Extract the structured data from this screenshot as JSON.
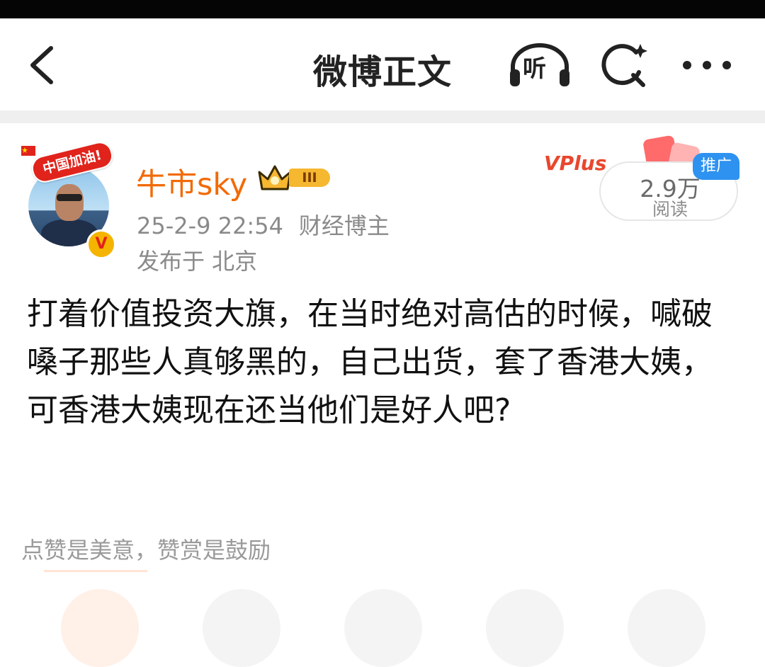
{
  "nav": {
    "title": "微博正文",
    "listen_label": "听"
  },
  "post": {
    "author": {
      "name": "牛市sky",
      "avatar_badge": "中国加油!",
      "verify_mark": "V",
      "level_badge": "III"
    },
    "timestamp": "25-2-9 22:54",
    "author_tag": "财经博主",
    "location": "发布于 北京",
    "promo": {
      "brand": "VPlus",
      "read_count": "2.9万",
      "read_label": "阅读",
      "ad_tag": "推广"
    },
    "body": "打着价值投资大旗，在当时绝对高估的时候，喊破嗓子那些人真够黑的，自己出货，套了香港大姨，可香港大姨现在还当他们是好人吧?",
    "reward_text": "点赞是美意，赞赏是鼓励"
  },
  "colors": {
    "username": "#f26a05",
    "meta_text": "#8a8a8a",
    "ad_tag_bg": "#2e92f0",
    "level_badge_bg": "#f6b731",
    "verify_badge_bg": "#f5b400"
  },
  "icons": {
    "back": "chevron-left-icon",
    "listen": "headphones-icon",
    "search": "search-sparkle-icon",
    "more": "more-dots-icon",
    "crown": "crown-icon"
  }
}
